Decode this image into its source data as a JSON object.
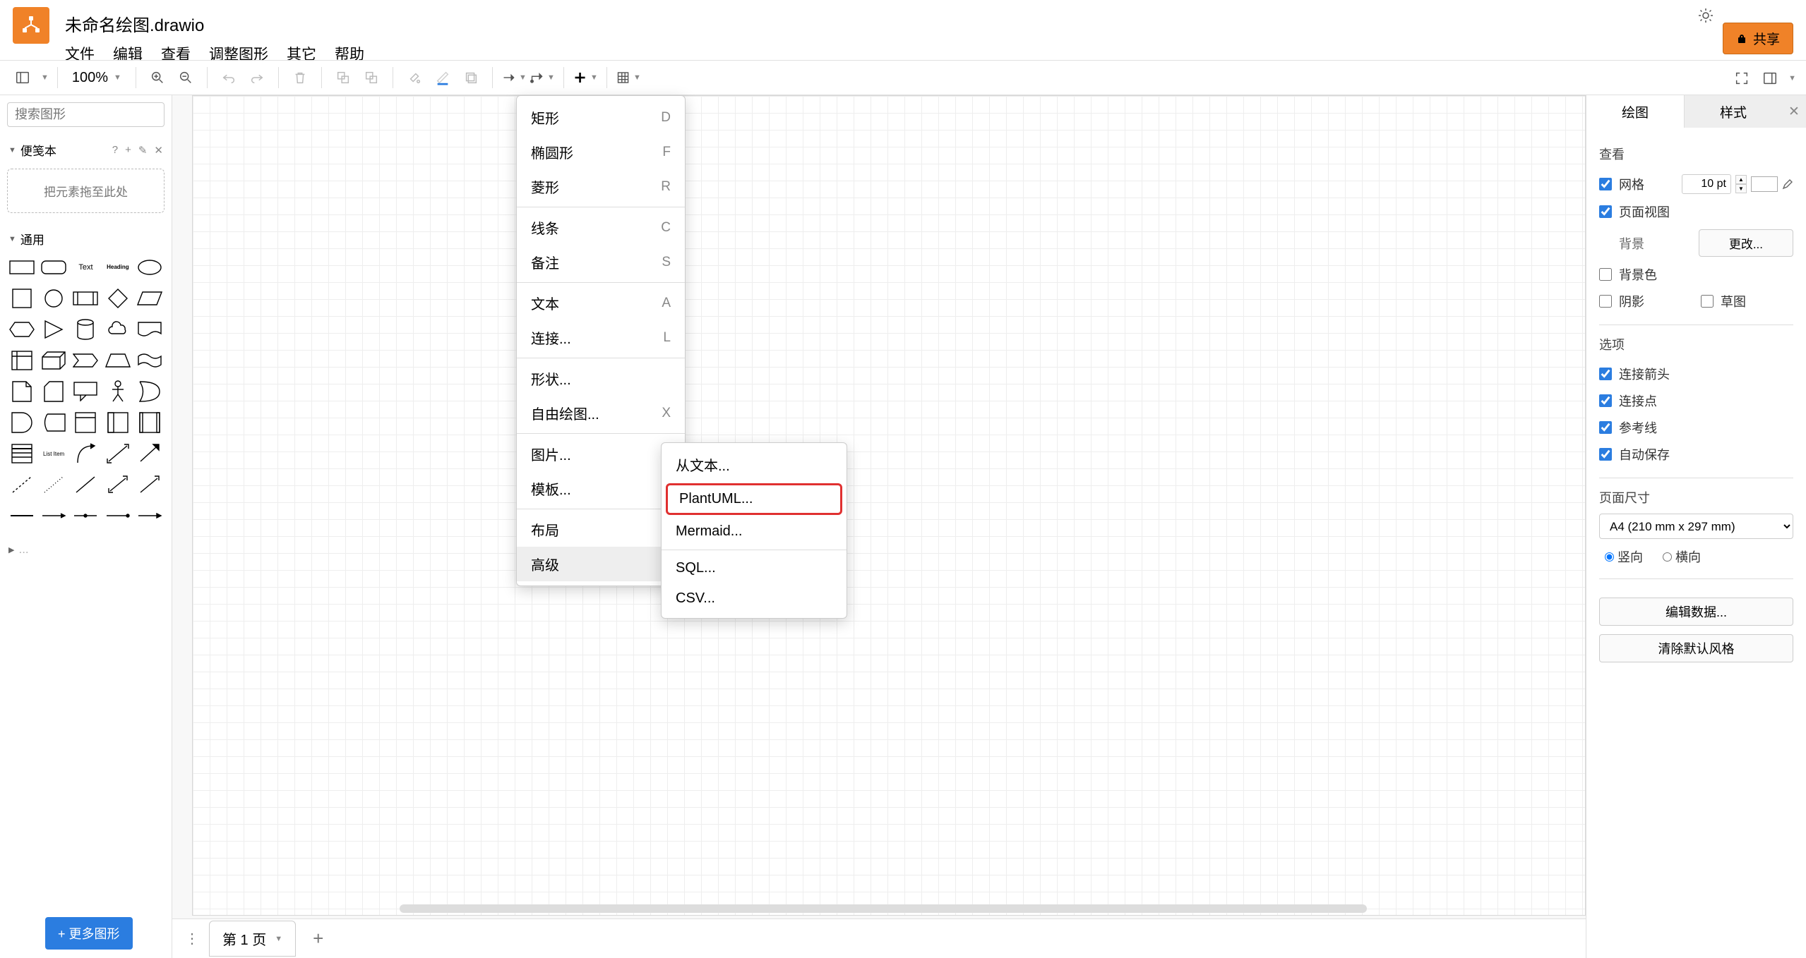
{
  "header": {
    "title": "未命名绘图.drawio",
    "menu": [
      "文件",
      "编辑",
      "查看",
      "调整图形",
      "其它",
      "帮助"
    ],
    "share": "共享"
  },
  "toolbar": {
    "zoom": "100%"
  },
  "sidebar": {
    "search_placeholder": "搜索图形",
    "scratchpad": "便笺本",
    "drop_hint": "把元素拖至此处",
    "general": "通用",
    "text_label": "Text",
    "heading_label": "Heading",
    "listitem_label": "List Item",
    "more_shapes": "+ 更多图形"
  },
  "pages": {
    "tab1": "第 1 页"
  },
  "menu1": {
    "items": [
      {
        "label": "矩形",
        "sc": "D"
      },
      {
        "label": "椭圆形",
        "sc": "F"
      },
      {
        "label": "菱形",
        "sc": "R"
      },
      {
        "sep": true
      },
      {
        "label": "线条",
        "sc": "C"
      },
      {
        "label": "备注",
        "sc": "S"
      },
      {
        "sep": true
      },
      {
        "label": "文本",
        "sc": "A"
      },
      {
        "label": "连接...",
        "sc": "L"
      },
      {
        "sep": true
      },
      {
        "label": "形状..."
      },
      {
        "label": "自由绘图...",
        "sc": "X"
      },
      {
        "sep": true
      },
      {
        "label": "图片..."
      },
      {
        "label": "模板..."
      },
      {
        "sep": true
      },
      {
        "label": "布局",
        "sub": true
      },
      {
        "label": "高级",
        "sub": true,
        "hl": true
      }
    ]
  },
  "submenu": {
    "items": [
      {
        "label": "从文本..."
      },
      {
        "label": "PlantUML...",
        "boxed": true
      },
      {
        "label": "Mermaid..."
      },
      {
        "sep": true
      },
      {
        "label": "SQL..."
      },
      {
        "label": "CSV..."
      }
    ]
  },
  "panel": {
    "tab_draw": "绘图",
    "tab_style": "样式",
    "view": "查看",
    "grid": "网格",
    "grid_size": "10 pt",
    "page_view": "页面视图",
    "background": "背景",
    "change": "更改...",
    "bgcolor": "背景色",
    "shadow": "阴影",
    "sketch": "草图",
    "options": "选项",
    "conn_arrow": "连接箭头",
    "conn_point": "连接点",
    "guide": "参考线",
    "autosave": "自动保存",
    "page_size": "页面尺寸",
    "size_value": "A4 (210 mm x 297 mm)",
    "portrait": "竖向",
    "landscape": "横向",
    "edit_data": "编辑数据...",
    "clear_style": "清除默认风格"
  }
}
